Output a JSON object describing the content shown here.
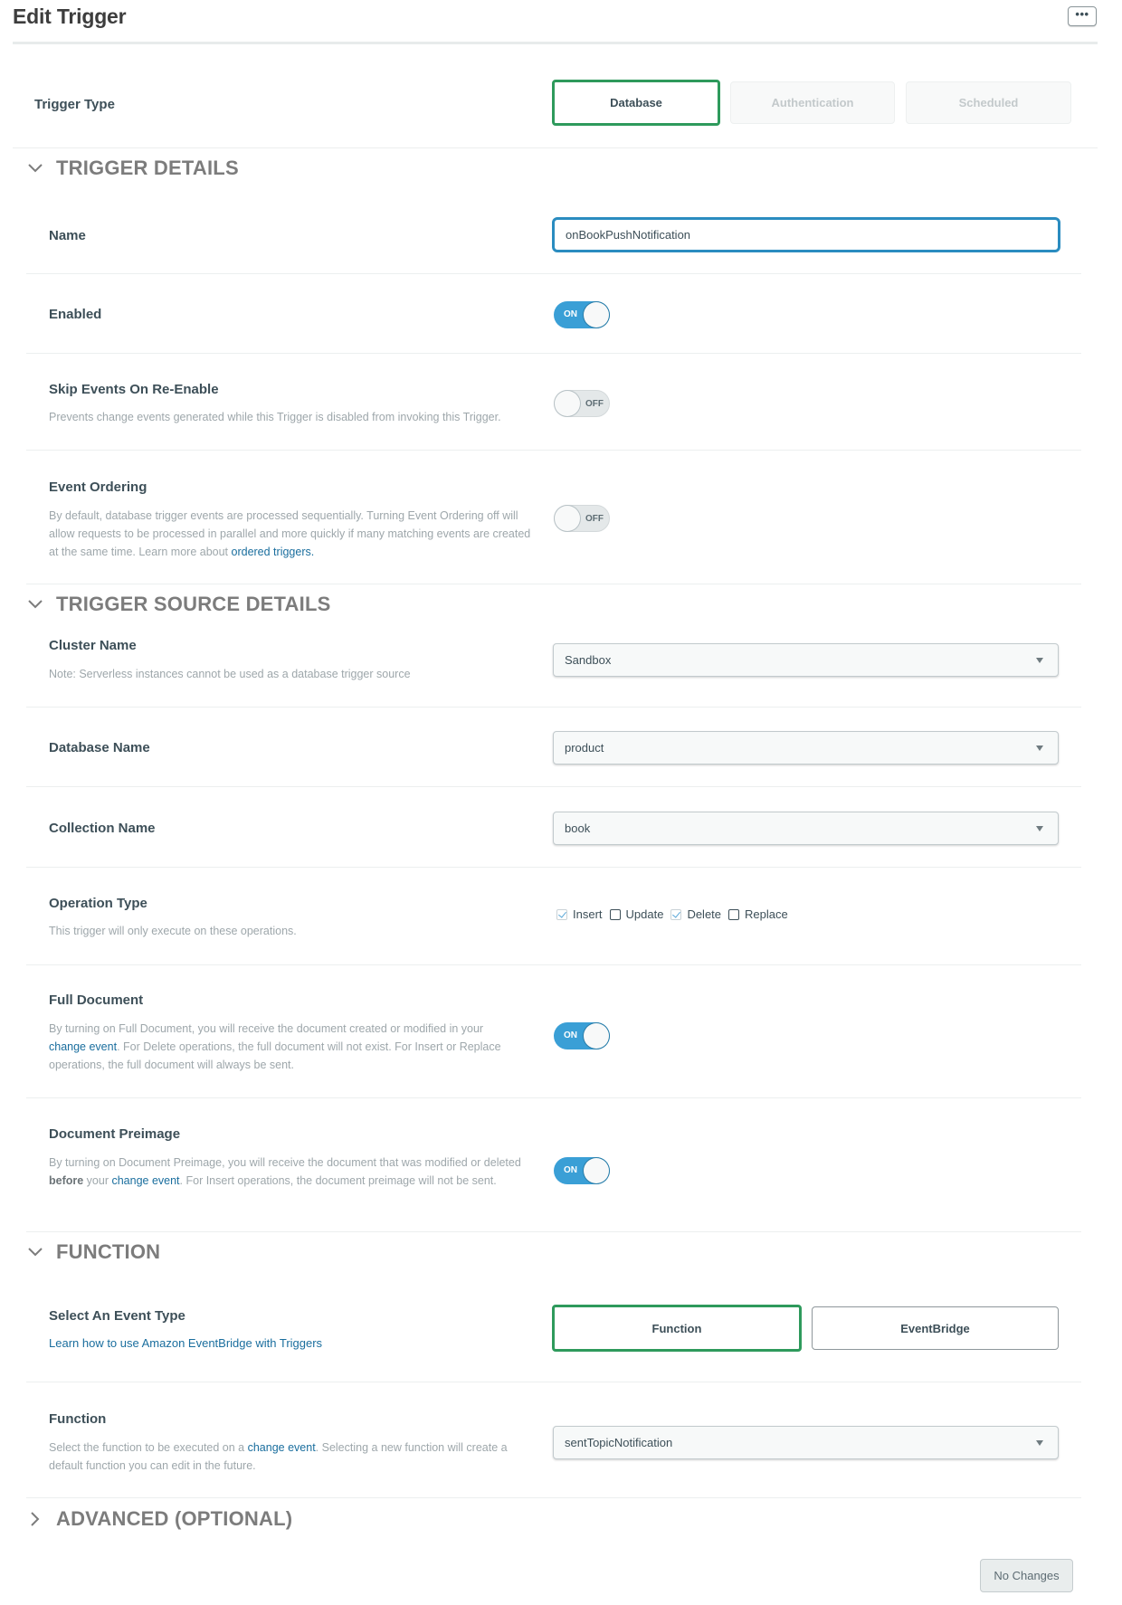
{
  "header": {
    "title": "Edit Trigger",
    "more_button_label": "•••"
  },
  "trigger_type": {
    "label": "Trigger Type",
    "options": [
      {
        "label": "Database",
        "selected": true
      },
      {
        "label": "Authentication",
        "selected": false
      },
      {
        "label": "Scheduled",
        "selected": false
      }
    ]
  },
  "sections": {
    "trigger_details": "TRIGGER DETAILS",
    "trigger_source_details": "TRIGGER SOURCE DETAILS",
    "function": "FUNCTION",
    "advanced": "ADVANCED (OPTIONAL)"
  },
  "trigger_details": {
    "name": {
      "label": "Name",
      "value": "onBookPushNotification"
    },
    "enabled": {
      "label": "Enabled",
      "state": "ON"
    },
    "skip_events": {
      "label": "Skip Events On Re-Enable",
      "description": "Prevents change events generated while this Trigger is disabled from invoking this Trigger.",
      "state": "OFF"
    },
    "event_ordering": {
      "label": "Event Ordering",
      "description": "By default, database trigger events are processed sequentially. Turning Event Ordering off will allow requests to be processed in parallel and more quickly if many matching events are created at the same time. Learn more about ",
      "link": "ordered triggers.",
      "state": "OFF"
    }
  },
  "source": {
    "cluster": {
      "label": "Cluster Name",
      "note": "Note: Serverless instances cannot be used as a database trigger source",
      "value": "Sandbox"
    },
    "database": {
      "label": "Database Name",
      "value": "product"
    },
    "collection": {
      "label": "Collection Name",
      "value": "book"
    },
    "operation_type": {
      "label": "Operation Type",
      "description": "This trigger will only execute on these operations.",
      "options": [
        {
          "label": "Insert",
          "checked": true
        },
        {
          "label": "Update",
          "checked": false
        },
        {
          "label": "Delete",
          "checked": true
        },
        {
          "label": "Replace",
          "checked": false
        }
      ]
    },
    "full_document": {
      "label": "Full Document",
      "desc_pre": "By turning on Full Document, you will receive the document created or modified in your ",
      "desc_link": "change event",
      "desc_post": ". For Delete operations, the full document will not exist. For Insert or Replace operations, the full document will always be sent.",
      "state": "ON"
    },
    "preimage": {
      "label": "Document Preimage",
      "desc_pre": "By turning on Document Preimage, you will receive the document that was modified or deleted ",
      "desc_bold": "before",
      "desc_mid": " your ",
      "desc_link": "change event",
      "desc_post": ". For Insert operations, the document preimage will not be sent.",
      "state": "ON"
    }
  },
  "function_section": {
    "event_type": {
      "label": "Select An Event Type",
      "link": "Learn how to use Amazon EventBridge with Triggers",
      "options": [
        {
          "label": "Function",
          "selected": true
        },
        {
          "label": "EventBridge",
          "selected": false
        }
      ]
    },
    "function": {
      "label": "Function",
      "desc_pre": "Select the function to be executed on a ",
      "desc_link": "change event",
      "desc_post": ". Selecting a new function will create a default function you can edit in the future.",
      "value": "sentTopicNotification"
    }
  },
  "footer": {
    "save_button_label": "No Changes"
  },
  "colors": {
    "selected_border": "#2e9a5c",
    "focus_border": "#2a8cc0",
    "toggle_on": "#3a9fd6",
    "link": "#1a6e9e"
  }
}
